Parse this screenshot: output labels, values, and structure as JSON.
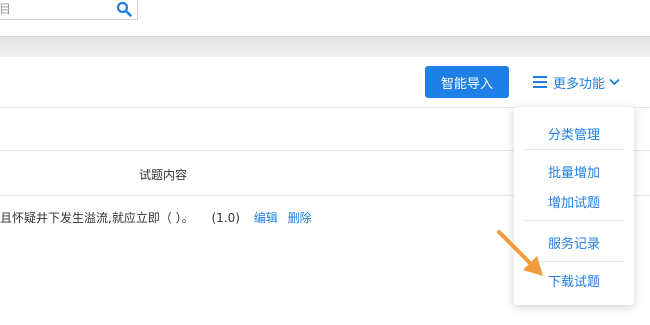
{
  "search": {
    "text": "目"
  },
  "toolbar": {
    "import_label": "智能导入",
    "more_label": "更多功能"
  },
  "table": {
    "column_header": "试题内容",
    "rows": [
      {
        "text": "且怀疑井下发生溢流,就应立即（   ）。",
        "score": "(1.0)",
        "edit": "编辑",
        "delete": "删除"
      }
    ]
  },
  "dropdown": {
    "items": [
      "分类管理",
      "批量增加",
      "增加试题",
      "服务记录",
      "下载试题"
    ]
  },
  "colors": {
    "accent": "#1e7fe6",
    "arrow": "#f39c3c"
  },
  "icons": [
    "search-icon",
    "menu-icon",
    "chevron-down-icon",
    "pointer-arrow-icon"
  ]
}
